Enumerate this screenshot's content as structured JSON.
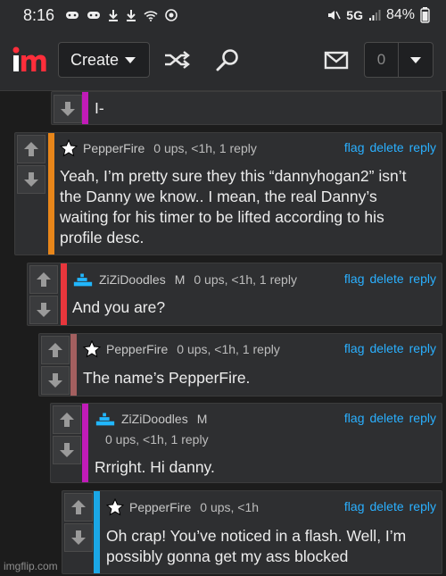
{
  "status_bar": {
    "time": "8:16",
    "network": "5G",
    "battery": "84%"
  },
  "header": {
    "create_label": "Create",
    "notification_count": "0"
  },
  "comments": [
    {
      "user": "",
      "stats": "",
      "text": "I-",
      "actions": []
    },
    {
      "user": "PepperFire",
      "stats": "0 ups, <1h, 1 reply",
      "text": "Yeah, I’m pretty sure they this “dannyhogan2” isn’t the Danny we know.. I mean, the real Danny’s waiting for his timer to be lifted according to his profile desc.",
      "actions": [
        "flag",
        "delete",
        "reply"
      ],
      "bar_color": "#e8861a"
    },
    {
      "user": "ZiZiDoodles",
      "mod": "M",
      "stats": "0 ups, <1h, 1 reply",
      "text": "And you are?",
      "actions": [
        "flag",
        "delete",
        "reply"
      ],
      "bar_color": "#e8363c"
    },
    {
      "user": "PepperFire",
      "stats": "0 ups, <1h, 1 reply",
      "text": "The name’s PepperFire.",
      "actions": [
        "flag",
        "delete",
        "reply"
      ],
      "bar_color": "#a35f5f"
    },
    {
      "user": "ZiZiDoodles",
      "mod": "M",
      "stats": "0 ups, <1h, 1 reply",
      "text": "Rrright. Hi danny.",
      "actions": [
        "flag",
        "delete",
        "reply"
      ],
      "bar_color": "#c11bb8"
    },
    {
      "user": "PepperFire",
      "stats": "0 ups, <1h",
      "text": "Oh crap! You’ve noticed in a flash. Well, I’m possibly gonna get my ass blocked",
      "actions": [
        "flag",
        "delete",
        "reply"
      ],
      "bar_color": "#1aa7e6"
    }
  ],
  "watermark": "imgflip.com",
  "colors": {
    "link": "#2ab0ff",
    "background": "#1c1c1c",
    "panel": "#2e2f31"
  },
  "icons": [
    "shuffle-icon",
    "search-icon",
    "mail-icon",
    "star-icon",
    "zizi-avatar-icon",
    "upvote-icon",
    "downvote-icon"
  ]
}
